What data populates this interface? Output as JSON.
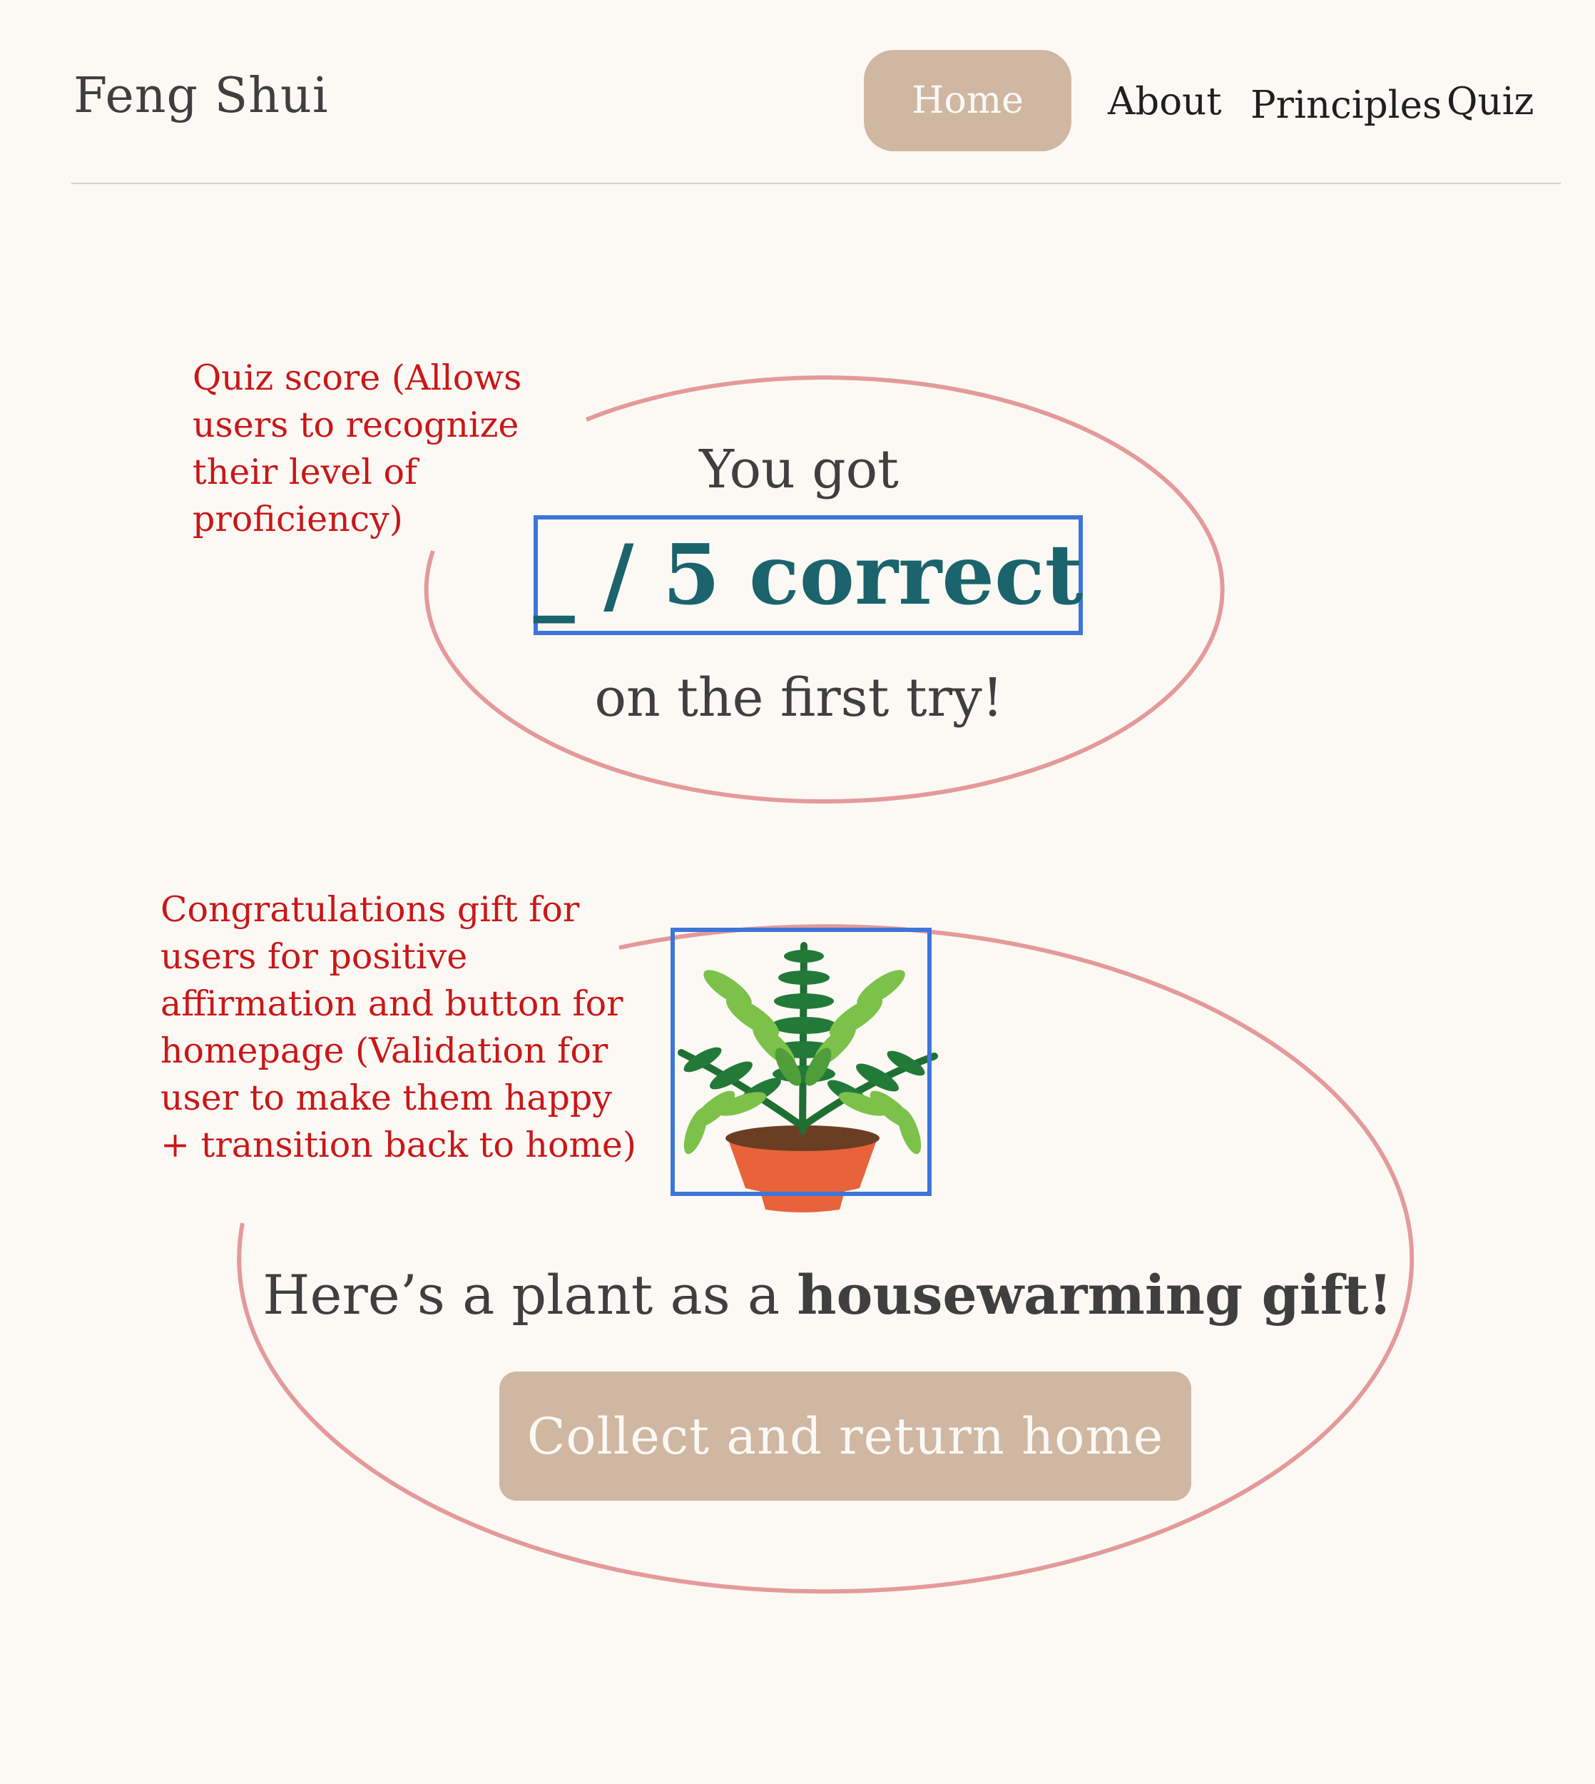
{
  "header": {
    "brand": "Feng Shui",
    "nav": {
      "home": "Home",
      "about": "About",
      "principles": "Principles",
      "quiz": "Quiz"
    }
  },
  "annotations": {
    "score_note": [
      "Quiz score (Allows",
      "users to recognize",
      "their level of",
      "proficiency)"
    ],
    "gift_note": [
      "Congratulations gift for",
      "users for positive",
      "affirmation and button for",
      "homepage (Validation for",
      "user to make them happy",
      "+ transition back to home)"
    ]
  },
  "score": {
    "intro": "You got",
    "value": "_ / 5 correct",
    "outro": "on the first try!"
  },
  "gift": {
    "icon": "potted-fern-icon",
    "text_prefix": "Here’s a plant as a ",
    "text_bold": "housewarming gift!",
    "button_label": "Collect and return home"
  },
  "colors": {
    "background": "#fcf9f5",
    "accent_button": "#d0b7a1",
    "score_text": "#1b636d",
    "annotation_text": "#c91717",
    "annotation_ellipse": "#e49a9a",
    "annotation_box": "#3e75d8"
  }
}
